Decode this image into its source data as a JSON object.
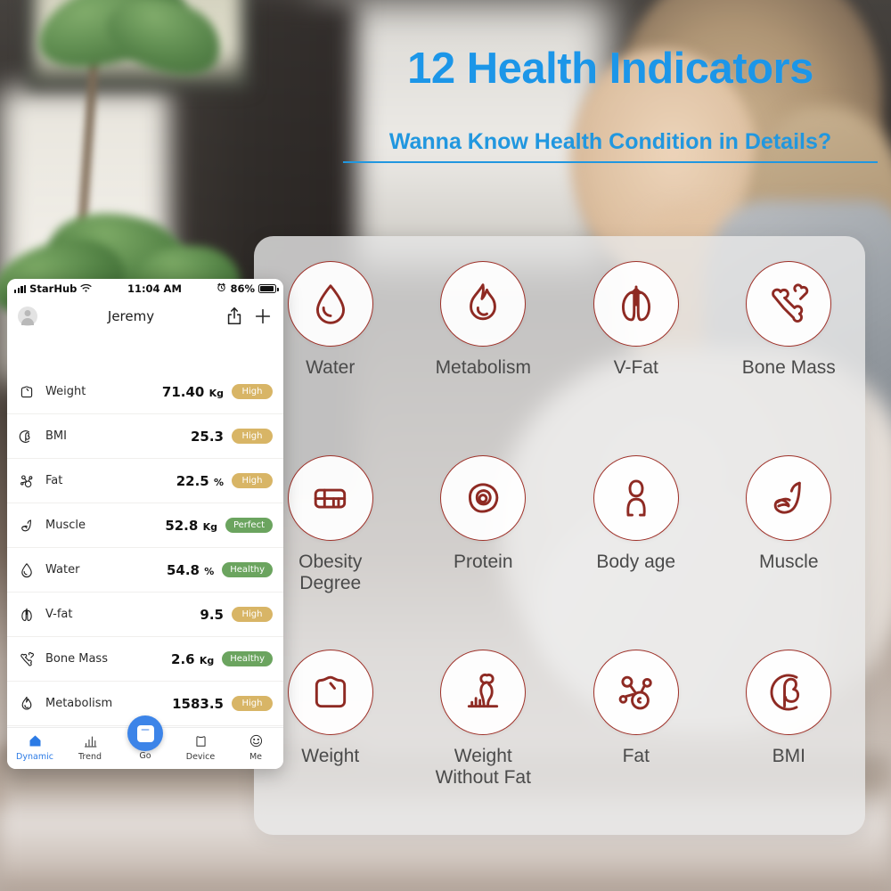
{
  "hero": {
    "headline": "12 Health Indicators",
    "subhead": "Wanna Know Health Condition in Details?",
    "accent_color": "#1C96E8"
  },
  "indicators_panel": {
    "accent_color": "#8E2A23",
    "items": [
      {
        "label": "Water",
        "icon": "water-drop-icon"
      },
      {
        "label": "Metabolism",
        "icon": "flame-icon"
      },
      {
        "label": "V-Fat",
        "icon": "lungs-icon"
      },
      {
        "label": "Bone Mass",
        "icon": "bone-icon"
      },
      {
        "label": "Obesity Degree",
        "icon": "body-scale-icon"
      },
      {
        "label": "Protein",
        "icon": "protein-cell-icon"
      },
      {
        "label": "Body age",
        "icon": "person-icon"
      },
      {
        "label": "Muscle",
        "icon": "flexed-arm-icon"
      },
      {
        "label": "Weight",
        "icon": "weight-scale-icon"
      },
      {
        "label": "Weight Without Fat",
        "icon": "figure-chart-icon"
      },
      {
        "label": "Fat",
        "icon": "molecule-icon"
      },
      {
        "label": "BMI",
        "icon": "bmi-beta-icon"
      }
    ]
  },
  "phone": {
    "status_bar": {
      "carrier": "StarHub",
      "time": "11:04 AM",
      "battery": "86%",
      "signal_icon": "signal-bars-icon",
      "wifi_icon": "wifi-icon",
      "alarm_icon": "alarm-clock-icon",
      "battery_icon": "battery-icon"
    },
    "nav": {
      "avatar_icon": "avatar-icon",
      "title": "Jeremy",
      "share_icon": "share-icon",
      "add_icon": "plus-icon"
    },
    "measurements": [
      {
        "icon": "weight-scale-icon",
        "label": "Weight",
        "value": "71.40",
        "unit": "Kg",
        "badge": "High",
        "badge_type": "high"
      },
      {
        "icon": "bmi-beta-icon",
        "label": "BMI",
        "value": "25.3",
        "unit": "",
        "badge": "High",
        "badge_type": "high"
      },
      {
        "icon": "molecule-icon",
        "label": "Fat",
        "value": "22.5",
        "unit": "%",
        "badge": "High",
        "badge_type": "high"
      },
      {
        "icon": "flexed-arm-icon",
        "label": "Muscle",
        "value": "52.8",
        "unit": "Kg",
        "badge": "Perfect",
        "badge_type": "good"
      },
      {
        "icon": "water-drop-icon",
        "label": "Water",
        "value": "54.8",
        "unit": "%",
        "badge": "Healthy",
        "badge_type": "good"
      },
      {
        "icon": "lungs-icon",
        "label": "V-fat",
        "value": "9.5",
        "unit": "",
        "badge": "High",
        "badge_type": "high"
      },
      {
        "icon": "bone-icon",
        "label": "Bone Mass",
        "value": "2.6",
        "unit": "Kg",
        "badge": "Healthy",
        "badge_type": "good"
      },
      {
        "icon": "flame-icon",
        "label": "Metabolism",
        "value": "1583.5",
        "unit": "",
        "badge": "High",
        "badge_type": "high"
      }
    ],
    "tabs": [
      {
        "label": "Dynamic",
        "icon": "home-icon",
        "active": true
      },
      {
        "label": "Trend",
        "icon": "chart-icon",
        "active": false
      },
      {
        "label": "Go",
        "icon": "scale-icon",
        "active": false
      },
      {
        "label": "Device",
        "icon": "device-icon",
        "active": false
      },
      {
        "label": "Me",
        "icon": "smiley-icon",
        "active": false
      }
    ],
    "badge_colors": {
      "high": "#D8B566",
      "good": "#6BA45F"
    },
    "accent_color": "#2C7BE5"
  }
}
